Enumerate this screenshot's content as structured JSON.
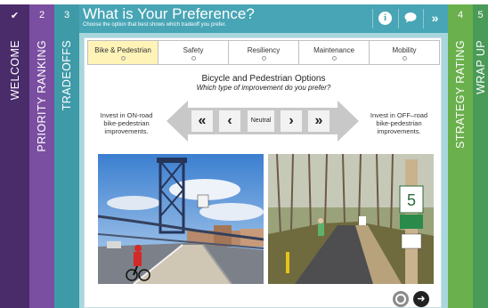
{
  "steps": {
    "welcome": {
      "num": "✔",
      "label": "WELCOME"
    },
    "priority": {
      "num": "2",
      "label": "PRIORITY RANKING"
    },
    "tradeoffs": {
      "num": "3",
      "label": "TRADEOFFS"
    },
    "strategy": {
      "num": "4",
      "label": "STRATEGY RATING"
    },
    "wrap": {
      "num": "5",
      "label": "WRAP UP"
    }
  },
  "header": {
    "title": "What is Your Preference?",
    "subtitle": "Choose the option that best shows which tradeoff you prefer.",
    "info_icon": "i",
    "chat_icon": "💬",
    "next_icon": "»"
  },
  "subtabs": [
    {
      "label": "Bike & Pedestrian",
      "active": true
    },
    {
      "label": "Safety",
      "active": false
    },
    {
      "label": "Resiliency",
      "active": false
    },
    {
      "label": "Maintenance",
      "active": false
    },
    {
      "label": "Mobility",
      "active": false
    }
  ],
  "option": {
    "title": "Bicycle and Pedestrian Options",
    "question": "Which type of improvement do you prefer?",
    "left_text": "Invest in ON-road bike-pedestrian improvements.",
    "right_text": "Invest in OFF–road bike-pedestrian improvements."
  },
  "slider": {
    "strong_left": "«",
    "left": "‹",
    "neutral": "Neutral",
    "right": "›",
    "strong_right": "»"
  },
  "nav": {
    "next": "➜"
  },
  "colors": {
    "welcome": "#4a2c6b",
    "priority": "#7a4ea0",
    "tradeoffs": "#3f9aa8",
    "strategy": "#6ab04c",
    "wrap": "#4a9a58",
    "header": "#47a5b5",
    "active_tab": "#fff3b8"
  }
}
